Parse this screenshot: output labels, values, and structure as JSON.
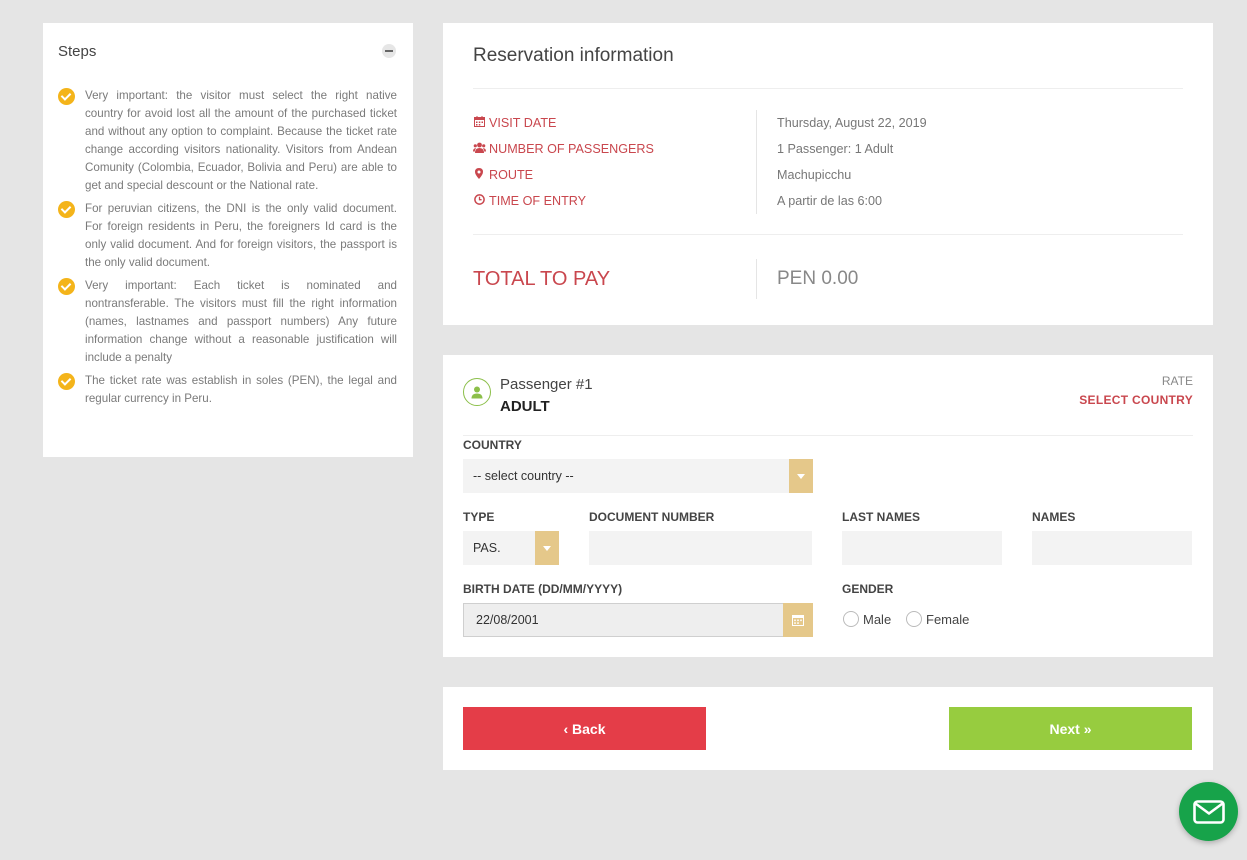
{
  "steps": {
    "title": "Steps",
    "items": [
      "Very important: the visitor must select the right native country for avoid lost all the amount of the purchased ticket and without any option to complaint. Because the ticket rate change according visitors nationality. Visitors from Andean Comunity (Colombia, Ecuador, Bolivia and Peru) are able to get and special descount or the National rate.",
      "For peruvian citizens, the DNI is the only valid document. For foreign residents in Peru, the foreigners Id card is the only valid document. And for foreign visitors, the passport is the only valid document.",
      "Very important: Each ticket is nominated and nontransferable. The visitors must fill the right information (names, lastnames and passport numbers) Any future information change without a reasonable justification will include a penalty",
      "The ticket rate was establish in soles (PEN), the legal and regular currency in Peru."
    ]
  },
  "reservation": {
    "title": "Reservation information",
    "rows": [
      {
        "icon": "calendar-icon",
        "label": "VISIT DATE",
        "value": "Thursday, August 22, 2019"
      },
      {
        "icon": "users-icon",
        "label": "NUMBER OF PASSENGERS",
        "value": "1 Passenger: 1 Adult"
      },
      {
        "icon": "map-marker-icon",
        "label": "ROUTE",
        "value": "Machupicchu"
      },
      {
        "icon": "clock-icon",
        "label": "TIME OF ENTRY",
        "value": "A partir de las 6:00"
      }
    ],
    "total_label": "TOTAL TO PAY",
    "total_value": "PEN 0.00"
  },
  "passenger": {
    "title": "Passenger #1",
    "type": "ADULT",
    "rate_label": "RATE",
    "rate_value": "SELECT COUNTRY",
    "country_label": "COUNTRY",
    "country_value": "-- select country --",
    "doc_type_label": "TYPE",
    "doc_type_value": "PAS.",
    "doc_number_label": "DOCUMENT NUMBER",
    "doc_number_value": "",
    "last_names_label": "LAST NAMES",
    "last_names_value": "",
    "names_label": "NAMES",
    "names_value": "",
    "birth_label": "BIRTH DATE (DD/MM/YYYY)",
    "birth_value": "22/08/2001",
    "gender_label": "GENDER",
    "gender_male": "Male",
    "gender_female": "Female"
  },
  "nav": {
    "back_label": "‹ Back",
    "next_label": "Next »"
  },
  "colors": {
    "accent_red": "#c9474e",
    "check_yellow": "#f4b41a",
    "back_red": "#e43d48",
    "next_green": "#97cc3f",
    "select_gold": "#e5c88a",
    "mail_green": "#17a34a"
  }
}
